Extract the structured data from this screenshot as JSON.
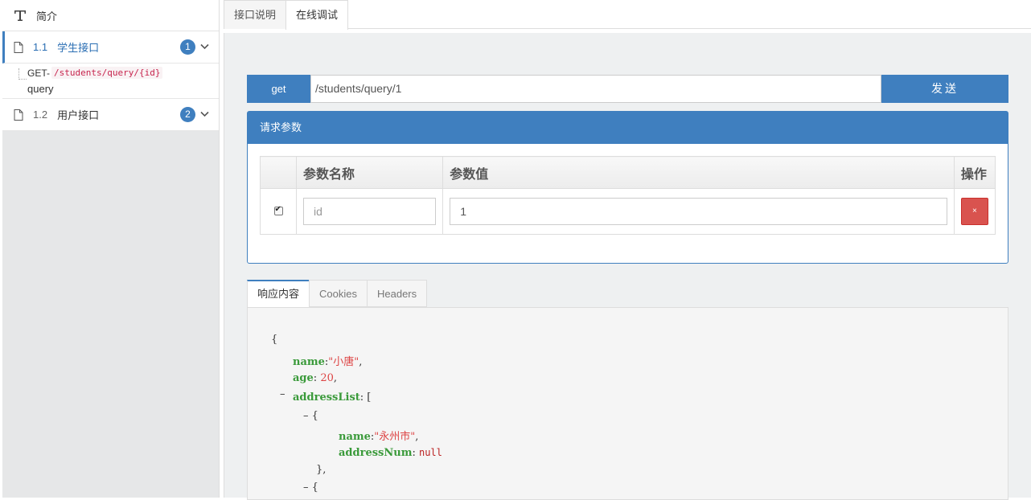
{
  "sidebar": {
    "intro_label": "简介",
    "items": [
      {
        "num": "1.1",
        "name": "学生接口",
        "badge": "1",
        "active": true
      },
      {
        "num": "1.2",
        "name": "用户接口",
        "badge": "2",
        "active": false
      }
    ],
    "sub": {
      "method": "GET-",
      "path": "/students/query/{id}",
      "summary": "query"
    }
  },
  "top_tabs": [
    {
      "label": "接口说明"
    },
    {
      "label": "在线调试"
    }
  ],
  "request": {
    "method": "get",
    "url": "/students/query/1",
    "send_label": "发送"
  },
  "params_panel": {
    "title": "请求参数",
    "headers": [
      "",
      "参数名称",
      "参数值",
      "操作"
    ],
    "rows": [
      {
        "checked": true,
        "name": "id",
        "value": "1",
        "delete_label": "×"
      }
    ]
  },
  "response_tabs": [
    {
      "label": "响应内容"
    },
    {
      "label": "Cookies"
    },
    {
      "label": "Headers"
    }
  ],
  "response": {
    "open_brace": "{",
    "name_key": "name",
    "name_val": "\"小唐\"",
    "age_key": "age",
    "age_val": "20",
    "list_key": "addressList",
    "open_bracket": "[",
    "item_toggle": "– {",
    "addr_name_key": "name",
    "addr_name_val": "\"永州市\"",
    "addr_num_key": "addressNum",
    "addr_num_val": "null",
    "close_item": "},",
    "collapse_mark": "–",
    "colon": ":",
    "comma": ","
  },
  "colors": {
    "accent": "#3f7fbf",
    "danger": "#d9534f",
    "key": "#3a9a3a",
    "string": "#dd4444"
  }
}
